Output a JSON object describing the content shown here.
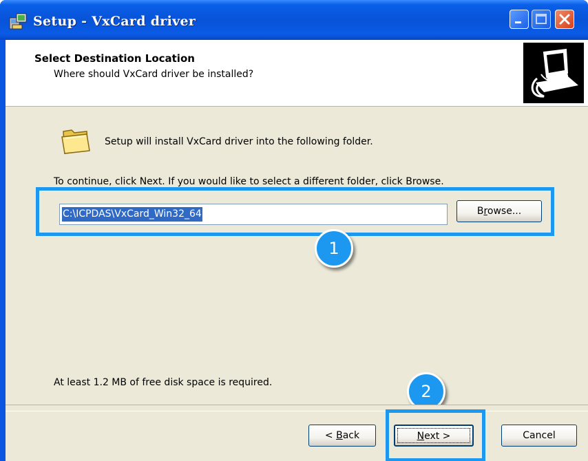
{
  "window": {
    "title": "Setup - VxCard driver",
    "buttons": {
      "minimize": "minimize-icon",
      "maximize": "maximize-icon",
      "close": "close-icon"
    }
  },
  "header": {
    "title": "Select Destination Location",
    "subtitle": "Where should VxCard driver be installed?",
    "image": "computer-install-icon"
  },
  "body": {
    "folder_message": "Setup will install VxCard driver into the following folder.",
    "instruction": "To continue, click Next. If you would like to select a different folder, click Browse.",
    "path_value": "C:\\ICPDAS\\VxCard_Win32_64",
    "browse_prefix": "B",
    "browse_accel": "r",
    "browse_suffix": "owse...",
    "space_required": "At least 1.2 MB of free disk space is required."
  },
  "annotations": {
    "badge1": "1",
    "badge2": "2",
    "highlight_color": "#1c98f0"
  },
  "footer": {
    "back_prefix": "< ",
    "back_accel": "B",
    "back_suffix": "ack",
    "next_accel": "N",
    "next_suffix": "ext >",
    "cancel_label": "Cancel"
  },
  "colors": {
    "titlebar": "#0853d8",
    "dialog_bg": "#ece9d8",
    "selection": "#316ac5"
  }
}
